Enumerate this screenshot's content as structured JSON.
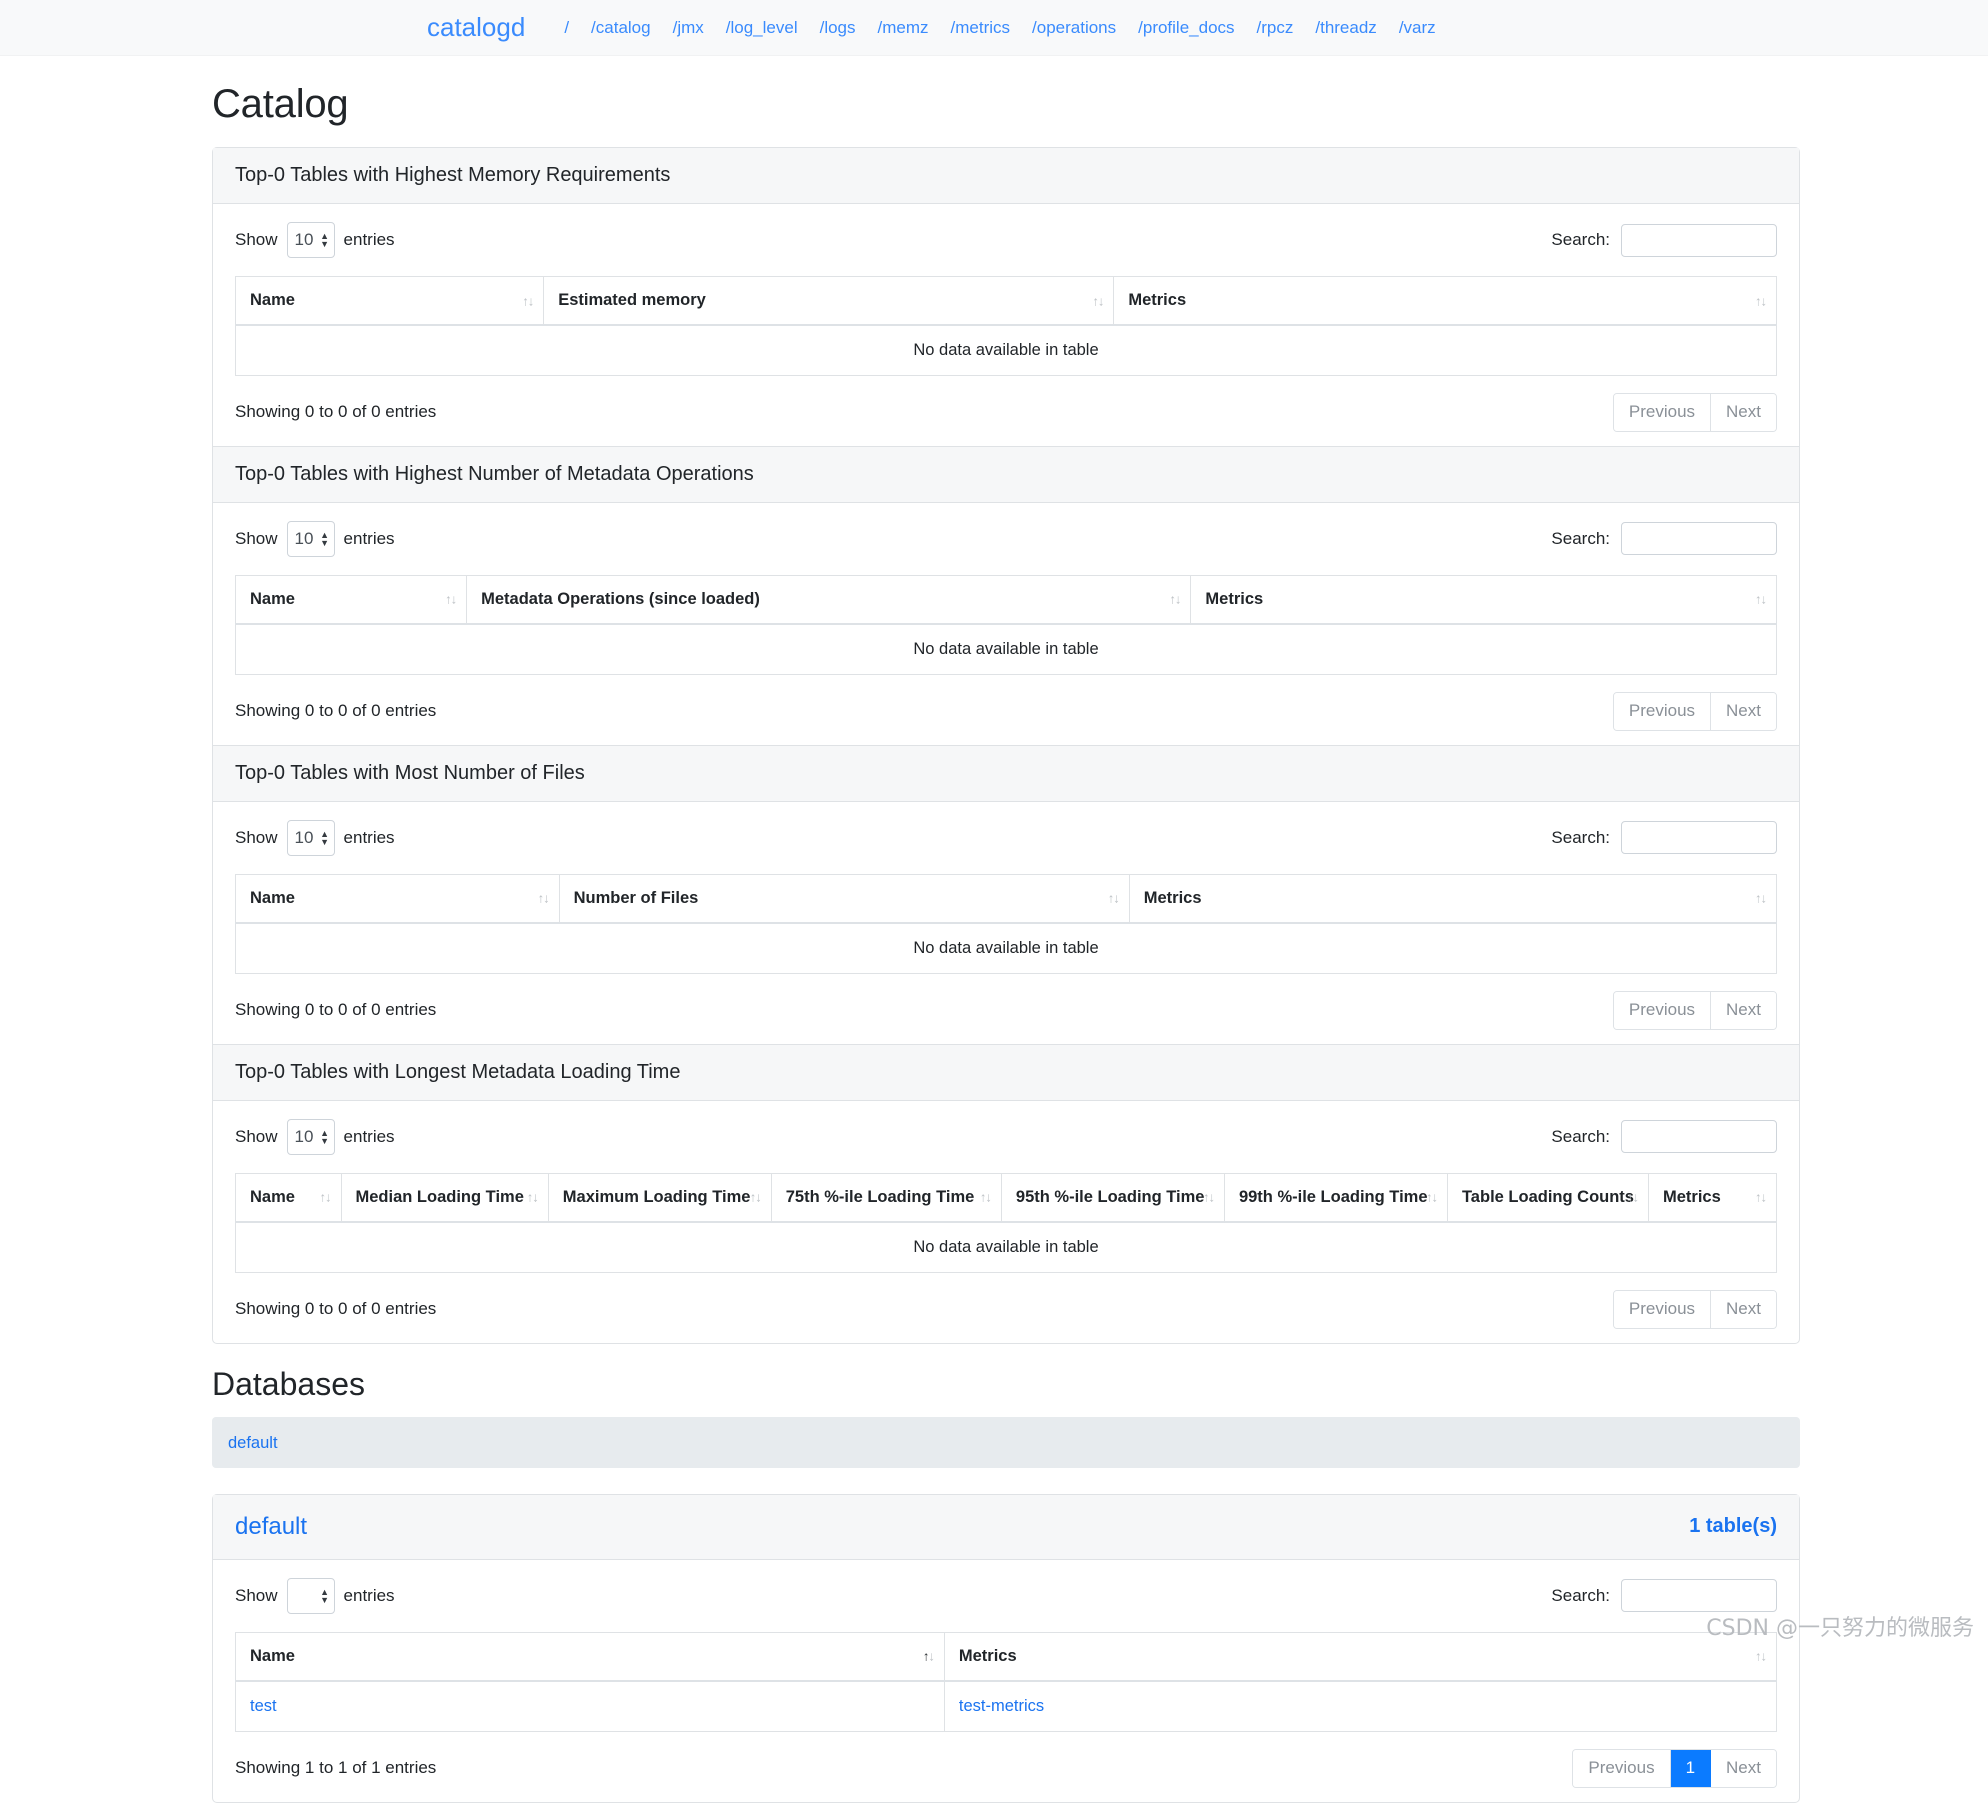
{
  "navbar": {
    "brand": "catalogd",
    "links": [
      "/",
      "/catalog",
      "/jmx",
      "/log_level",
      "/logs",
      "/memz",
      "/metrics",
      "/operations",
      "/profile_docs",
      "/rpcz",
      "/threadz",
      "/varz"
    ]
  },
  "page": {
    "title": "Catalog",
    "databases_title": "Databases"
  },
  "labels": {
    "show": "Show",
    "entries": "entries",
    "search": "Search:",
    "search_placeholder": "",
    "no_data": "No data available in table",
    "previous": "Previous",
    "next": "Next"
  },
  "colors": {
    "accent": "#1a73f0",
    "nav_link": "#3a8bfd",
    "active_page": "#0b7bff",
    "card_header_bg": "#f6f7f8",
    "db_list_bg": "#e7ebee"
  },
  "cards": [
    {
      "title": "Top-0 Tables with Highest Memory Requirements",
      "page_length": "10",
      "search_value": "",
      "columns": [
        "Name",
        "Estimated memory",
        "Metrics"
      ],
      "col_widths": [
        "20%",
        "37%",
        "43%"
      ],
      "rows": [],
      "info": "Showing 0 to 0 of 0 entries",
      "paging": []
    },
    {
      "title": "Top-0 Tables with Highest Number of Metadata Operations",
      "page_length": "10",
      "search_value": "",
      "columns": [
        "Name",
        "Metadata Operations (since loaded)",
        "Metrics"
      ],
      "col_widths": [
        "15%",
        "47%",
        "38%"
      ],
      "rows": [],
      "info": "Showing 0 to 0 of 0 entries",
      "paging": []
    },
    {
      "title": "Top-0 Tables with Most Number of Files",
      "page_length": "10",
      "search_value": "",
      "columns": [
        "Name",
        "Number of Files",
        "Metrics"
      ],
      "col_widths": [
        "21%",
        "37%",
        "42%"
      ],
      "rows": [],
      "info": "Showing 0 to 0 of 0 entries",
      "paging": []
    },
    {
      "title": "Top-0 Tables with Longest Metadata Loading Time",
      "page_length": "10",
      "search_value": "",
      "columns": [
        "Name",
        "Median Loading Time",
        "Maximum Loading Time",
        "75th %-ile Loading Time",
        "95th %-ile Loading Time",
        "99th %-ile Loading Time",
        "Table Loading Counts",
        "Metrics"
      ],
      "col_widths": [
        "7%",
        "13.5%",
        "14.5%",
        "15%",
        "14.5%",
        "14.5%",
        "12.5%",
        "8.5%"
      ],
      "rows": [],
      "info": "Showing 0 to 0 of 0 entries",
      "paging": []
    }
  ],
  "databases": {
    "list": [
      "default"
    ],
    "cards": [
      {
        "name": "default",
        "count_label": "1 table(s)",
        "page_length": "",
        "search_value": "",
        "columns": [
          "Name",
          "Metrics"
        ],
        "col_widths": [
          "46%",
          "54%"
        ],
        "sorted_column": 0,
        "rows": [
          [
            {
              "text": "test",
              "link": true
            },
            {
              "text": "test-metrics",
              "link": true
            }
          ]
        ],
        "info": "Showing 1 to 1 of 1 entries",
        "paging": [
          "1"
        ]
      }
    ]
  },
  "watermark": "CSDN @一只努力的微服务"
}
